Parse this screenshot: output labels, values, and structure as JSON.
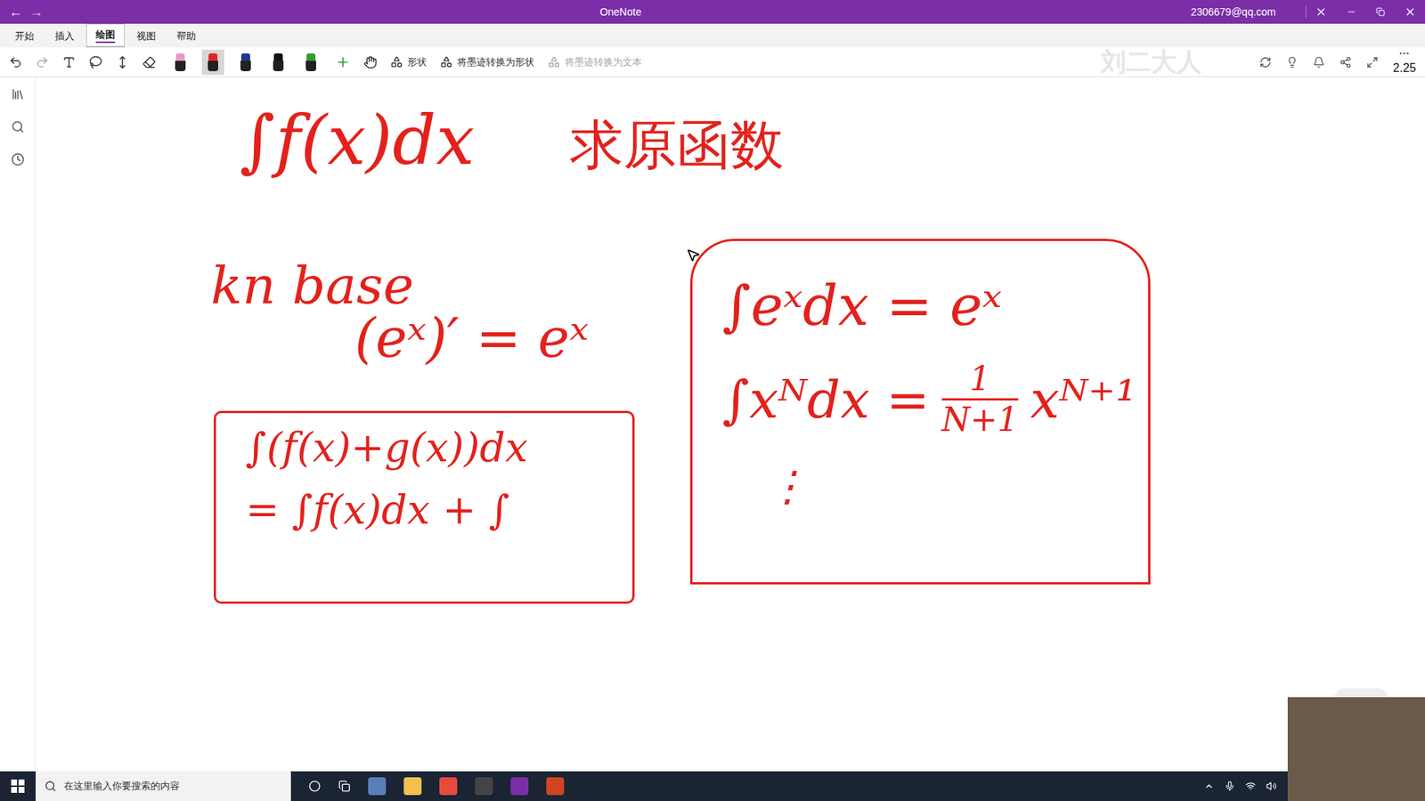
{
  "window": {
    "title": "OneNote",
    "account": "2306679@qq.com",
    "back": "←",
    "forward": "→"
  },
  "menu_tabs": [
    {
      "label": "开始",
      "selected": false
    },
    {
      "label": "插入",
      "selected": false
    },
    {
      "label": "绘图",
      "selected": true
    },
    {
      "label": "视图",
      "selected": false
    },
    {
      "label": "帮助",
      "selected": false
    }
  ],
  "pens": [
    {
      "color": "#e89ac7",
      "selected": false
    },
    {
      "color": "#e02424",
      "selected": true
    },
    {
      "color": "#1f3a8a",
      "selected": false
    },
    {
      "color": "#111111",
      "selected": false
    },
    {
      "color": "#2e9e2e",
      "selected": false
    }
  ],
  "toolbar": {
    "tools": [
      {
        "label": "形状",
        "disabled": false
      },
      {
        "label": "将墨迹转换为形状",
        "disabled": false
      },
      {
        "label": "将墨迹转换为文本",
        "disabled": true
      }
    ],
    "zoom": "2.25"
  },
  "watermark": "刘二大人",
  "ink": {
    "title": "∫f(x)dx",
    "note": "求原函数",
    "heading": "kn base",
    "derivative": "(eˣ)′ = eˣ",
    "left_box": {
      "lines": [
        "∫(f(x)+g(x))dx",
        "= ∫f(x)dx + ∫"
      ]
    },
    "right_box": {
      "line1": "∫eˣdx = eˣ",
      "line2": "∫xᴺdx =",
      "numerator": "1",
      "denominator": "N+1",
      "power": "xᴺ⁺¹",
      "more": "⋮"
    }
  },
  "taskbar": {
    "search_placeholder": "在这里输入你要搜索的内容"
  }
}
